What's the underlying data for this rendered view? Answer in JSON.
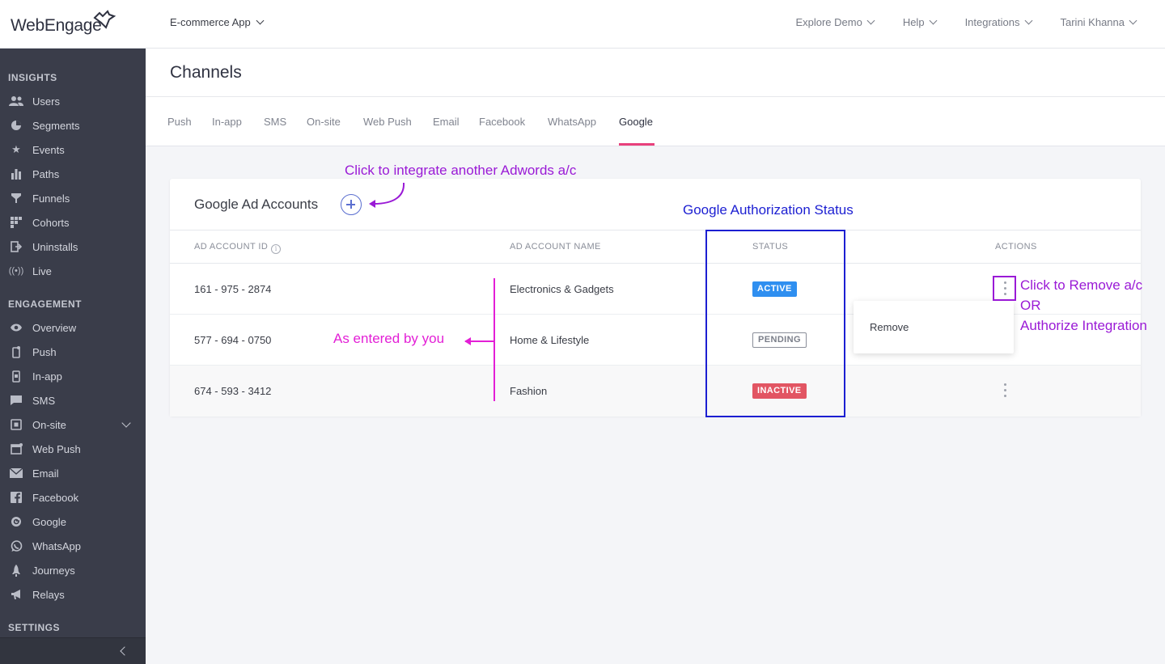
{
  "header": {
    "logo_text": "WebEngage",
    "app_name": "E-commerce App",
    "menu": [
      {
        "label": "Explore Demo"
      },
      {
        "label": "Help"
      },
      {
        "label": "Integrations"
      },
      {
        "label": "Tarini Khanna"
      }
    ]
  },
  "sidebar": {
    "sections": [
      {
        "title": "INSIGHTS"
      },
      {
        "title": "ENGAGEMENT"
      },
      {
        "title": "SETTINGS"
      }
    ],
    "insights_items": [
      {
        "label": "Users",
        "icon": "users-icon"
      },
      {
        "label": "Segments",
        "icon": "pie-icon"
      },
      {
        "label": "Events",
        "icon": "star-icon"
      },
      {
        "label": "Paths",
        "icon": "bar-icon"
      },
      {
        "label": "Funnels",
        "icon": "funnel-icon"
      },
      {
        "label": "Cohorts",
        "icon": "grid-icon"
      },
      {
        "label": "Uninstalls",
        "icon": "exit-icon"
      },
      {
        "label": "Live",
        "icon": "broadcast-icon"
      }
    ],
    "engagement_items": [
      {
        "label": "Overview",
        "icon": "eye-icon"
      },
      {
        "label": "Push",
        "icon": "phone-icon"
      },
      {
        "label": "In-app",
        "icon": "phone-icon"
      },
      {
        "label": "SMS",
        "icon": "chat-icon"
      },
      {
        "label": "On-site",
        "icon": "window-icon"
      },
      {
        "label": "Web Push",
        "icon": "browser-icon"
      },
      {
        "label": "Email",
        "icon": "mail-icon"
      },
      {
        "label": "Facebook",
        "icon": "facebook-icon"
      },
      {
        "label": "Google",
        "icon": "google-icon"
      },
      {
        "label": "WhatsApp",
        "icon": "whatsapp-icon"
      },
      {
        "label": "Journeys",
        "icon": "rocket-icon"
      },
      {
        "label": "Relays",
        "icon": "megaphone-icon"
      }
    ]
  },
  "page": {
    "title": "Channels",
    "tabs": [
      "Push",
      "In-app",
      "SMS",
      "On-site",
      "Web Push",
      "Email",
      "Facebook",
      "WhatsApp",
      "Google"
    ],
    "active_tab": "Google"
  },
  "card": {
    "title": "Google Ad Accounts",
    "columns": {
      "id": "AD ACCOUNT ID",
      "name": "AD ACCOUNT NAME",
      "status": "STATUS",
      "actions": "ACTIONS"
    },
    "rows": [
      {
        "id": "161 - 975 - 2874",
        "name": "Electronics & Gadgets",
        "status": "ACTIVE"
      },
      {
        "id": "577 - 694 - 0750",
        "name": "Home & Lifestyle",
        "status": "PENDING"
      },
      {
        "id": "674 - 593 - 3412",
        "name": "Fashion",
        "status": "INACTIVE"
      }
    ],
    "dropdown": {
      "option": "Remove"
    }
  },
  "annotations": {
    "integrate": "Click to integrate another Adwords a/c",
    "auth_status": "Google Authorization Status",
    "remove_line1": "Click to Remove a/c",
    "remove_line2": "OR",
    "remove_line3": "Authorize Integration",
    "entered": "As entered by you"
  },
  "colors": {
    "sidebar_bg": "#3a3d4a",
    "tab_accent": "#e8407c",
    "active_badge": "#2f8ff0",
    "inactive_badge": "#e25563",
    "annotation_violet": "#9a1ad6",
    "annotation_blue": "#1c1fd2",
    "annotation_pink": "#e31fd6"
  }
}
